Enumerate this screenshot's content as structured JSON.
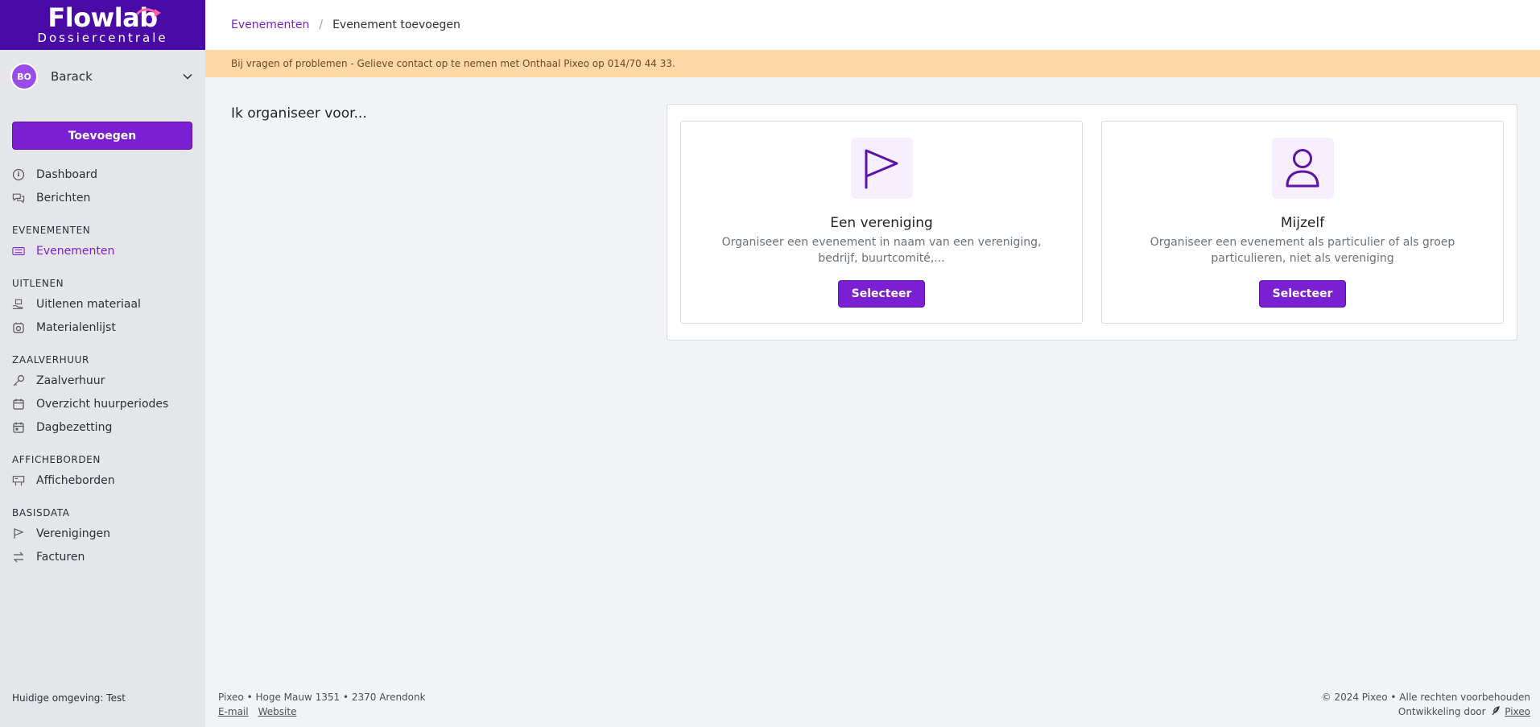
{
  "brand": {
    "title": "Flowlab",
    "subtitle": "Dossiercentrale",
    "color": "#4a0aa6",
    "accent": "#7a1fd1"
  },
  "user": {
    "initials": "BO",
    "name": "Barack"
  },
  "sidebar": {
    "add_label": "Toevoegen",
    "top_items": [
      {
        "label": "Dashboard",
        "icon": "dashboard-icon"
      },
      {
        "label": "Berichten",
        "icon": "messages-icon"
      }
    ],
    "sections": [
      {
        "title": "EVENEMENTEN",
        "items": [
          {
            "label": "Evenementen",
            "icon": "ticket-icon",
            "active": true
          }
        ]
      },
      {
        "title": "UITLENEN",
        "items": [
          {
            "label": "Uitlenen materiaal",
            "icon": "hand-box-icon"
          },
          {
            "label": "Materialenlijst",
            "icon": "box-icon"
          }
        ]
      },
      {
        "title": "ZAALVERHUUR",
        "items": [
          {
            "label": "Zaalverhuur",
            "icon": "key-icon"
          },
          {
            "label": "Overzicht huurperiodes",
            "icon": "calendar-icon"
          },
          {
            "label": "Dagbezetting",
            "icon": "calendar-day-icon"
          }
        ]
      },
      {
        "title": "AFFICHEBORDEN",
        "items": [
          {
            "label": "Afficheborden",
            "icon": "billboard-icon"
          }
        ]
      },
      {
        "title": "BASISDATA",
        "items": [
          {
            "label": "Verenigingen",
            "icon": "flag-icon"
          },
          {
            "label": "Facturen",
            "icon": "arrows-exchange-icon"
          }
        ]
      }
    ],
    "environment": "Huidige omgeving: Test"
  },
  "breadcrumb": {
    "parent": "Evenementen",
    "separator": "/",
    "current": "Evenement toevoegen"
  },
  "notice": "Bij vragen of problemen - Gelieve contact op te nemen met Onthaal Pixeo op 014/70 44 33.",
  "main": {
    "heading": "Ik organiseer voor...",
    "cards": [
      {
        "title": "Een vereniging",
        "description": "Organiseer een evenement in naam van een vereniging, bedrijf, buurtcomité,...",
        "button": "Selecteer",
        "icon": "flag-icon"
      },
      {
        "title": "Mijzelf",
        "description": "Organiseer een evenement als particulier of als groep particulieren, niet als vereniging",
        "button": "Selecteer",
        "icon": "user-icon"
      }
    ]
  },
  "footer": {
    "address": "Pixeo • Hoge Mauw 1351 • 2370 Arendonk",
    "email_label": "E-mail",
    "website_label": "Website",
    "copyright": "© 2024 Pixeo • Alle rechten voorbehouden",
    "dev_prefix": "Ontwikkeling door",
    "dev_link": "Pixeo"
  }
}
